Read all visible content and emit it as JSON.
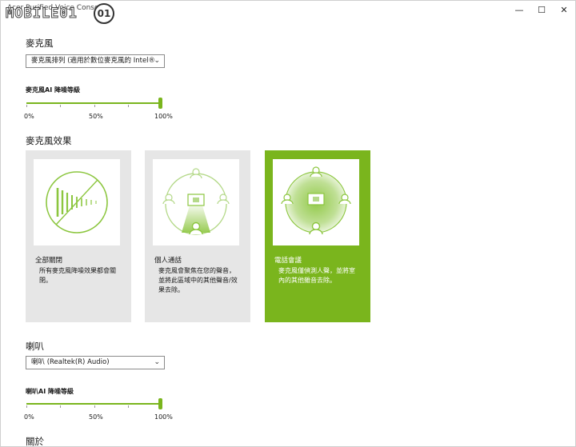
{
  "window": {
    "title": "Acer Purified Voice Console",
    "watermark": "MOBILE01",
    "controls": {
      "minimize": "—",
      "maximize": "☐",
      "close": "✕"
    }
  },
  "microphone": {
    "section_title": "麥克風",
    "device_selected": "麥克風排列 (適用於數位麥克風的 Intel®",
    "ai_label": "麥克風AI 降噪等級",
    "ai_level": 1.0,
    "ticks": [
      "0%",
      "50%",
      "100%"
    ]
  },
  "effects": {
    "section_title": "麥克風效果",
    "cards": [
      {
        "title": "全部關閉",
        "description": "所有麥克風降噪效果都會關閉。",
        "selected": false,
        "icon": "sound-off-icon"
      },
      {
        "title": "個人通話",
        "description": "麥克風會聚焦在您的聲音，並將此區域中的其他聲音/效果去除。",
        "selected": false,
        "icon": "personal-call-icon"
      },
      {
        "title": "電話會議",
        "description": "麥克風僅偵測人聲，並將室內的其他雜音去除。",
        "selected": true,
        "icon": "conference-call-icon"
      }
    ]
  },
  "speaker": {
    "section_title": "喇叭",
    "device_selected": "喇叭 (Realtek(R) Audio)",
    "ai_label": "喇叭AI 降噪等級",
    "ai_level": 1.0,
    "ticks": [
      "0%",
      "50%",
      "100%"
    ]
  },
  "about": {
    "section_title": "關於"
  },
  "colors": {
    "accent": "#7ab51d",
    "card_bg": "#e6e6e6"
  }
}
